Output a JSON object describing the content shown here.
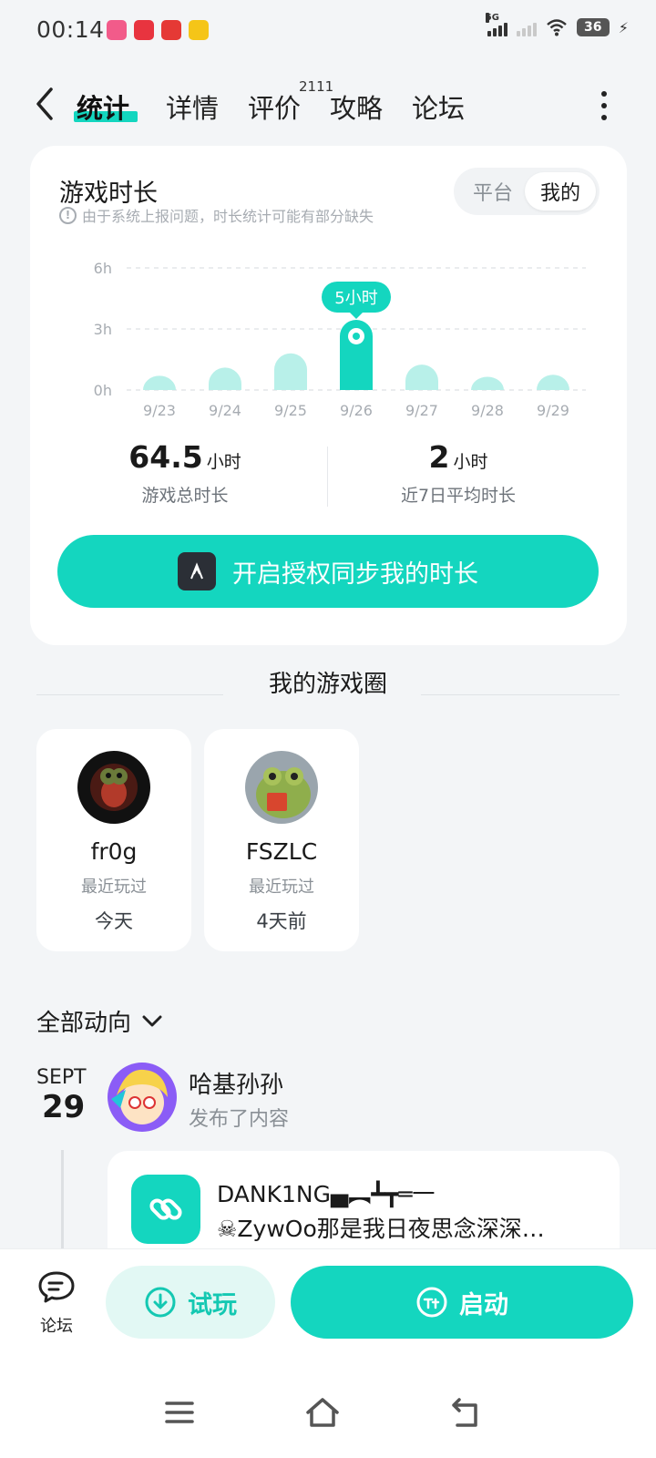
{
  "status_bar": {
    "time": "00:14",
    "network": "5G",
    "battery": "36"
  },
  "header": {
    "tabs": [
      {
        "label": "统计",
        "active": true
      },
      {
        "label": "详情"
      },
      {
        "label": "评价"
      },
      {
        "label": "攻略"
      },
      {
        "label": "论坛"
      }
    ],
    "review_count": "2111"
  },
  "stats_card": {
    "title": "游戏时长",
    "note": "由于系统上报问题，时长统计可能有部分缺失",
    "toggle": {
      "options": [
        "平台",
        "我的"
      ],
      "selected": "我的"
    },
    "total": {
      "value": "64.5",
      "unit": "小时",
      "label": "游戏总时长"
    },
    "average": {
      "value": "2",
      "unit": "小时",
      "label": "近7日平均时长"
    },
    "auth_button": "开启授权同步我的时长"
  },
  "chart_data": {
    "type": "bar",
    "categories": [
      "9/23",
      "9/24",
      "9/25",
      "9/26",
      "9/27",
      "9/28",
      "9/29"
    ],
    "values": [
      0.7,
      1.1,
      1.8,
      3.45,
      1.25,
      0.65,
      0.75
    ],
    "y_ticks": [
      "0h",
      "3h",
      "6h"
    ],
    "ylim": [
      0,
      6
    ],
    "highlight_index": 3,
    "highlight_label": "5小时",
    "grid": true,
    "colors": {
      "bar": "#b8f0e9",
      "highlight": "#14d6bf"
    }
  },
  "game_circle": {
    "title": "我的游戏圈",
    "friends": [
      {
        "name": "fr0g",
        "status": "最近玩过",
        "when": "今天"
      },
      {
        "name": "FSZLC",
        "status": "最近玩过",
        "when": "4天前"
      }
    ]
  },
  "feed": {
    "filter_label": "全部动向",
    "month": "SEPT",
    "day": "29",
    "user": "哈基孙孙",
    "action": "发布了内容",
    "post_title": "DANK1NG▄︻┻┳═一",
    "post_text": "☠ZywOo那是我日夜思念深深…"
  },
  "action_bar": {
    "forum_label": "论坛",
    "trial_label": "试玩",
    "launch_label": "启动"
  },
  "colors": {
    "accent": "#14d6bf",
    "accent_light": "#b8f0e9",
    "background": "#f3f5f7"
  }
}
